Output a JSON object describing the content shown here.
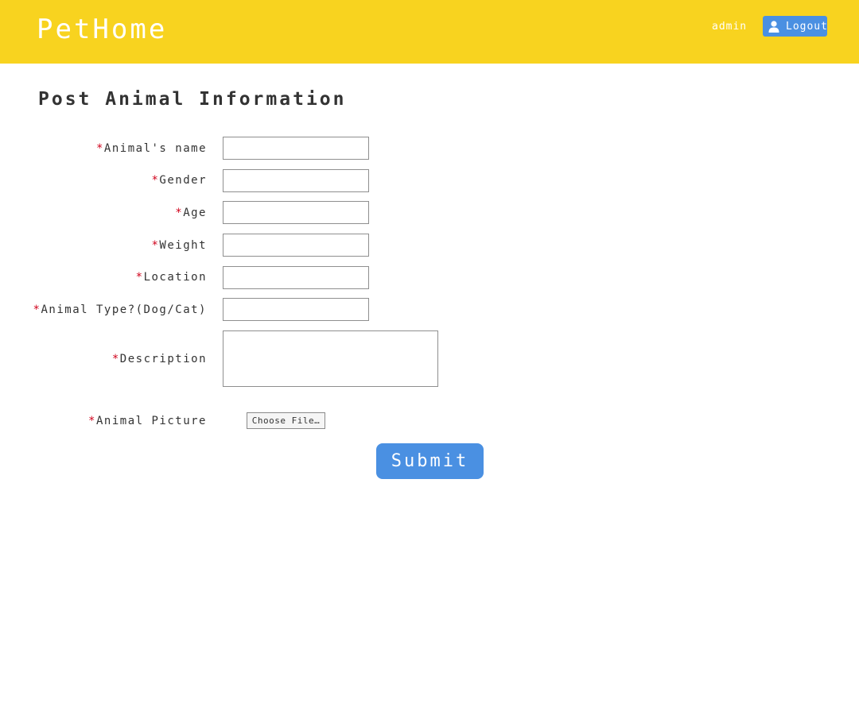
{
  "header": {
    "brand": "PetHome",
    "username": "admin",
    "logout_label": "Logout",
    "logout_icon": "user-icon",
    "background_color": "#f8d31f",
    "accent_color": "#4a90e2"
  },
  "page": {
    "title": "Post Animal Information"
  },
  "form": {
    "required_marker": "*",
    "required_color": "#d0021b",
    "fields": [
      {
        "label": "Animal's name",
        "value": ""
      },
      {
        "label": "Gender",
        "value": ""
      },
      {
        "label": "Age",
        "value": ""
      },
      {
        "label": "Weight",
        "value": ""
      },
      {
        "label": "Location",
        "value": ""
      },
      {
        "label": "Animal Type?(Dog/Cat)",
        "value": ""
      }
    ],
    "description": {
      "label": "Description",
      "value": ""
    },
    "picture": {
      "label": "Animal Picture",
      "button_label": "Choose File…"
    },
    "submit_label": "Submit"
  }
}
